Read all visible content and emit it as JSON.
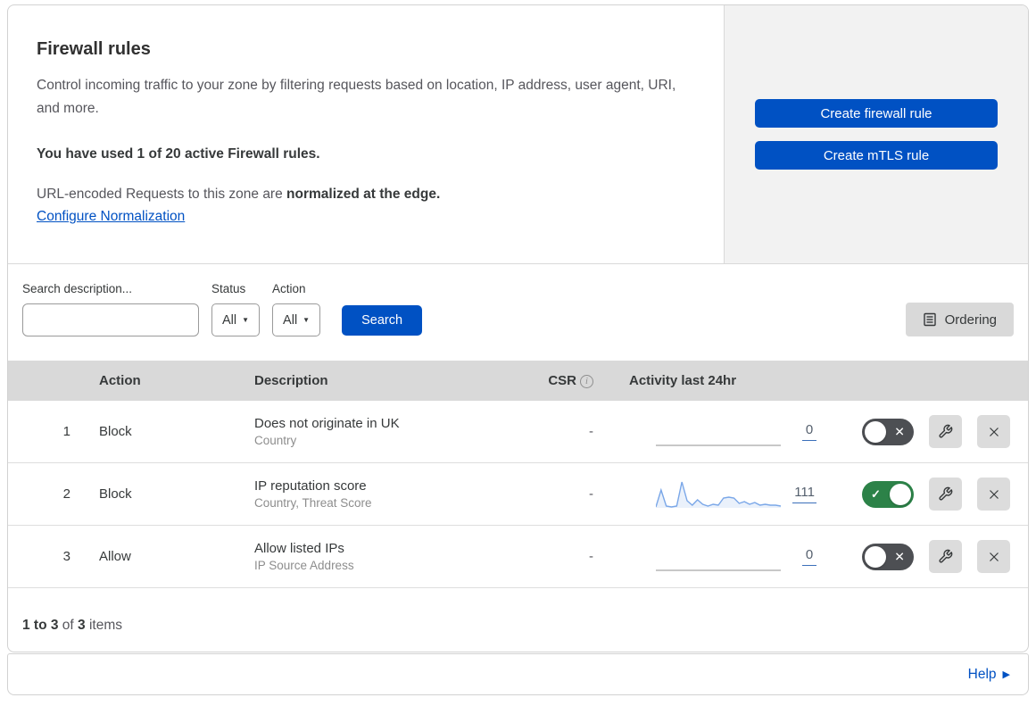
{
  "panel": {
    "title": "Firewall rules",
    "description": "Control incoming traffic to your zone by filtering requests based on location, IP address, user agent, URI, and more.",
    "usage_note": "You have used 1 of 20 active Firewall rules.",
    "normalization_text": "URL-encoded Requests to this zone are",
    "normalization_bold": "normalized at the edge.",
    "normalization_link": "Configure Normalization",
    "create_firewall_button": "Create firewall rule",
    "create_mtls_button": "Create mTLS rule"
  },
  "filters": {
    "search_label": "Search description...",
    "status_label": "Status",
    "status_value": "All",
    "action_label": "Action",
    "action_value": "All",
    "search_button": "Search",
    "ordering_button": "Ordering"
  },
  "table": {
    "headers": {
      "action": "Action",
      "description": "Description",
      "csr": "CSR",
      "activity": "Activity last 24hr"
    },
    "rows": [
      {
        "index": "1",
        "action": "Block",
        "description": "Does not originate in UK",
        "fields": "Country",
        "csr": "-",
        "count": "0",
        "enabled": false,
        "sparkline": []
      },
      {
        "index": "2",
        "action": "Block",
        "description": "IP reputation score",
        "fields": "Country, Threat Score",
        "csr": "-",
        "count": "111",
        "enabled": true,
        "sparkline": [
          1,
          20,
          2,
          1,
          2,
          29,
          8,
          3,
          9,
          4,
          2,
          4,
          3,
          11,
          12,
          11,
          5,
          7,
          4,
          6,
          3,
          4,
          3,
          3,
          2
        ]
      },
      {
        "index": "3",
        "action": "Allow",
        "description": "Allow listed IPs",
        "fields": "IP Source Address",
        "csr": "-",
        "count": "0",
        "enabled": false,
        "sparkline": []
      }
    ],
    "summary": {
      "range": "1 to 3",
      "of": "of",
      "total": "3",
      "items": "items"
    }
  },
  "footer": {
    "help_label": "Help"
  },
  "colors": {
    "accent_blue": "#0051c3",
    "toggle_on_green": "#2c8248",
    "toggle_off_gray": "#4d4f53",
    "sparkline_blue": "#7aa7e8",
    "table_header_gray": "#d9d9d9",
    "side_panel_gray": "#f2f2f2"
  }
}
